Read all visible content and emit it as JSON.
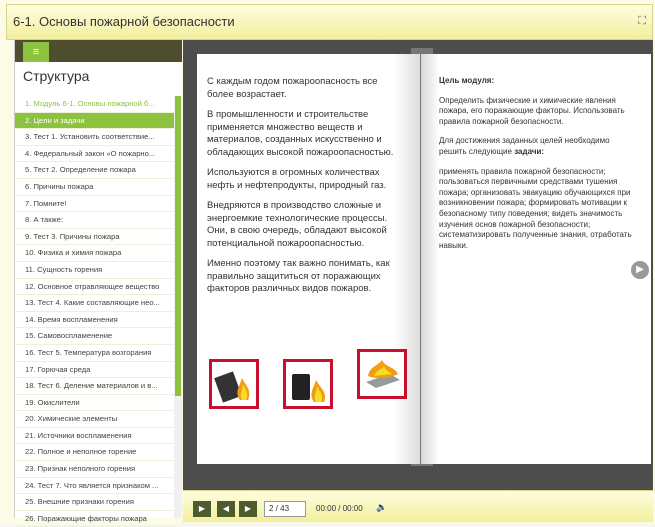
{
  "window": {
    "title": "6-1. Основы пожарной безопасности"
  },
  "sidebar": {
    "menu_icon": "≡",
    "heading": "Структура",
    "items": [
      "1.  Модуль 6-1. Основы пожарной б...",
      "2.  Цели и задачи",
      "3.  Тест 1. Установить соответствие...",
      "4.  Федеральный закон «О пожарно...",
      "5.  Тест 2. Определение пожара",
      "6.  Причины пожара",
      "7.  Помните!",
      "8.  А также:",
      "9.  Тест 3. Причины пожара",
      "10. Физика и химия пожара",
      "11. Сущность горения",
      "12. Основное отравляющее вещество",
      "13. Тест 4. Какие составляющие нео...",
      "14. Время воспламенения",
      "15. Самовоспламенение",
      "16. Тест 5. Температура возгорания",
      "17. Горючая среда",
      "18. Тест 6. Деление материалов и в...",
      "19. Окислители",
      "20. Химические элементы",
      "21. Источники воспламенения",
      "22. Полное и неполное горение",
      "23. Признак неполного горения",
      "24. Тест 7. Что является признаком ...",
      "25. Внешние признаки горения",
      "26. Поражающие факторы пожара"
    ]
  },
  "left_page": {
    "paragraphs": [
      "С каждым годом пожароопасность все более возрастает.",
      "В промышленности и строительстве применяется множество веществ и материалов, созданных искусственно и обладающих высокой пожароопасностью.",
      "Используются в огромных количествах нефть и нефтепродукты, природный газ.",
      "Внедряются в производство сложные и энергоемкие технологические процессы. Они, в свою очередь, обладают высокой потенциальной пожароопасностью.",
      "Именно поэтому так важно понимать, как правильно защититься от поражающих факторов различных видов пожаров."
    ]
  },
  "right_page": {
    "goal_label": "Цель модуля:",
    "goal_text": "Определить физические и химические явления пожара, его поражающие факторы. Использовать правила пожарной безопасности.",
    "tasks_intro": "Для достижения заданных целей необходимо решить следующие",
    "tasks_word": "задачи:",
    "tasks_text": "применять правила пожарной безопасности; пользоваться первичными средствами тушения пожара; организовать эвакуацию обучающихся при возникновении пожара; формировать мотивации к безопасному типу поведения; видеть значимость изучения основ пожарной безопасности; систематизировать полученные знания, отработать навыки."
  },
  "player": {
    "page": "2 / 43",
    "time": "00:00 / 00:00"
  },
  "colors": {
    "accent": "#8dc23f",
    "dark": "#4e4e2e",
    "fire_red": "#c8102e"
  }
}
